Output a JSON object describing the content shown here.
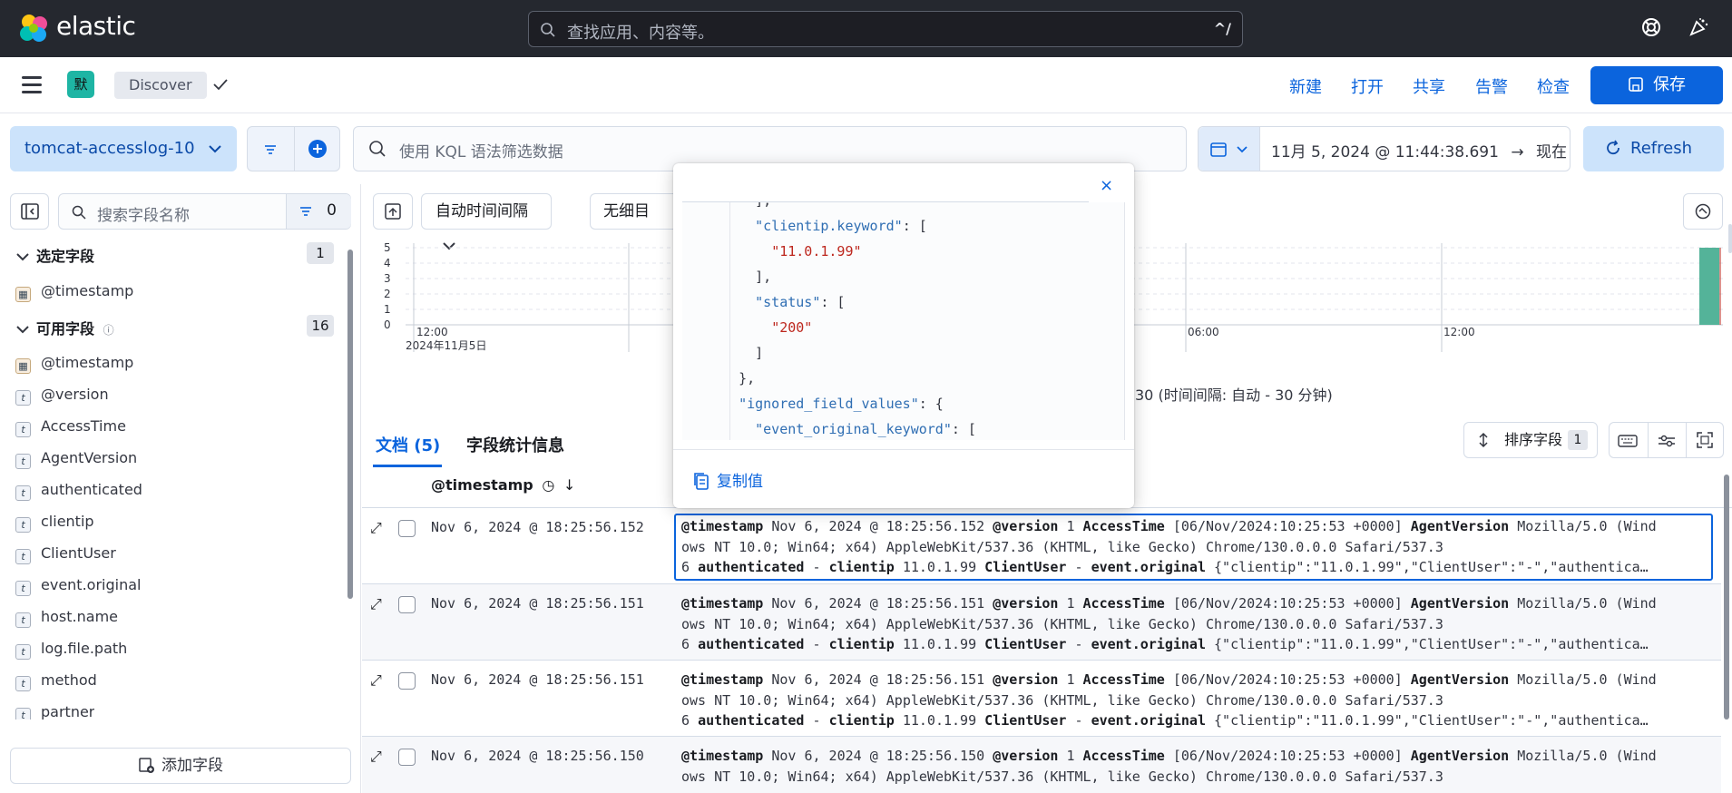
{
  "brand": {
    "name": "elastic"
  },
  "search": {
    "placeholder": "查找应用、内容等。",
    "shortcut": "^/"
  },
  "appbar": {
    "space_initial": "默",
    "breadcrumb": "Discover",
    "links": [
      "新建",
      "打开",
      "共享",
      "告警",
      "检查"
    ],
    "save_label": "保存"
  },
  "query": {
    "data_view": "tomcat-accesslog-10",
    "kql_placeholder": "使用 KQL 语法筛选数据",
    "date_range": "11月 5, 2024 @ 11:44:38.691",
    "date_to": "现在",
    "refresh_label": "Refresh"
  },
  "sidebar": {
    "search_placeholder": "搜索字段名称",
    "filter_count": "0",
    "selected_header": "选定字段",
    "selected_count": "1",
    "selected_fields": [
      {
        "name": "@timestamp",
        "type": "date"
      }
    ],
    "available_header": "可用字段",
    "available_count": "16",
    "available_fields": [
      {
        "name": "@timestamp",
        "type": "date"
      },
      {
        "name": "@version",
        "type": "t"
      },
      {
        "name": "AccessTime",
        "type": "t"
      },
      {
        "name": "AgentVersion",
        "type": "t"
      },
      {
        "name": "authenticated",
        "type": "t"
      },
      {
        "name": "clientip",
        "type": "t"
      },
      {
        "name": "ClientUser",
        "type": "t"
      },
      {
        "name": "event.original",
        "type": "t"
      },
      {
        "name": "host.name",
        "type": "t"
      },
      {
        "name": "log.file.path",
        "type": "t"
      },
      {
        "name": "method",
        "type": "t"
      },
      {
        "name": "partner",
        "type": "t"
      }
    ],
    "add_field_label": "添加字段"
  },
  "chart_controls": {
    "interval_label": "自动时间间隔",
    "breakdown_label": "无细目"
  },
  "histogram": {
    "y_ticks": [
      "5",
      "4",
      "3",
      "2",
      "1",
      "0"
    ],
    "x_ticks": [
      "12:00",
      "06:00",
      "12:00"
    ],
    "x_sub": "2024年11月5日",
    "interval_text": "30 (时间间隔: 自动 - 30 分钟)"
  },
  "tabs": {
    "documents": "文档 (5)",
    "field_stats": "字段统计信息"
  },
  "sort": {
    "label": "排序字段",
    "count": "1"
  },
  "table": {
    "timestamp_header": "@timestamp",
    "rows": [
      {
        "timestamp": "Nov 6, 2024 @ 18:25:56.152",
        "src_ts": "Nov 6, 2024 @ 18:25:56.152"
      },
      {
        "timestamp": "Nov 6, 2024 @ 18:25:56.151",
        "src_ts": "Nov 6, 2024 @ 18:25:56.151"
      },
      {
        "timestamp": "Nov 6, 2024 @ 18:25:56.151",
        "src_ts": "Nov 6, 2024 @ 18:25:56.151"
      },
      {
        "timestamp": "Nov 6, 2024 @ 18:25:56.150",
        "src_ts": "Nov 6, 2024 @ 18:25:56.150"
      }
    ],
    "labels": {
      "ts": "@timestamp",
      "version": "@version",
      "access": "AccessTime",
      "agent": "AgentVersion",
      "auth": "authenticated",
      "clientip": "clientip",
      "user": "ClientUser",
      "event": "event.original"
    },
    "values": {
      "version": "1",
      "access": "[06/Nov/2024:10:25:53 +0000]",
      "agent_a": "Mozilla/5.0 (Wind",
      "agent_b": "ows NT 10.0; Win64; x64) AppleWebKit/537.36 (KHTML, like Gecko) Chrome/130.0.0.0 Safari/537.3",
      "agent_c": "6",
      "auth": "-",
      "clientip": "11.0.1.99",
      "user": "-",
      "event": "{\"clientip\":\"11.0.1.99\",\"ClientUser\":\"-\",\"authentica…"
    }
  },
  "popover": {
    "copy_label": "复制值",
    "lines": [
      {
        "indent": 4,
        "text": "],",
        "kind": "p"
      },
      {
        "indent": 4,
        "key": "\"clientip.keyword\"",
        "text": ": [",
        "kind": "k"
      },
      {
        "indent": 6,
        "text": "\"11.0.1.99\"",
        "kind": "v"
      },
      {
        "indent": 4,
        "text": "],",
        "kind": "p"
      },
      {
        "indent": 4,
        "key": "\"status\"",
        "text": ": [",
        "kind": "k"
      },
      {
        "indent": 6,
        "text": "\"200\"",
        "kind": "v"
      },
      {
        "indent": 4,
        "text": "]",
        "kind": "p"
      },
      {
        "indent": 2,
        "text": "},",
        "kind": "p"
      },
      {
        "indent": 2,
        "key": "\"ignored_field_values\"",
        "text": ": {",
        "kind": "k"
      },
      {
        "indent": 4,
        "key": "\"event_original_keyword\"",
        "text": ": [",
        "kind": "k"
      }
    ]
  }
}
